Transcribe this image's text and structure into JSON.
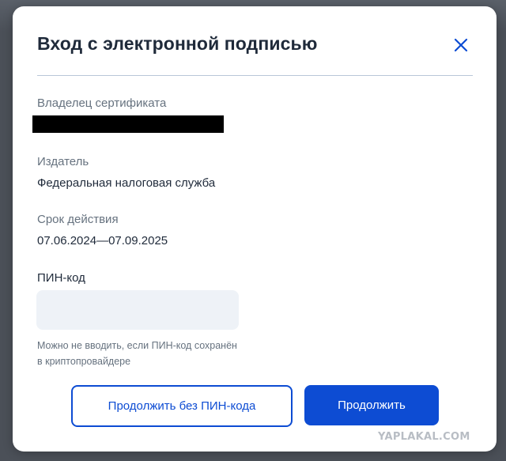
{
  "dialog": {
    "title": "Вход с электронной подписью",
    "close_icon": "close-icon"
  },
  "certificate": {
    "owner_label": "Владелец сертификата",
    "issuer_label": "Издатель",
    "issuer_value": "Федеральная налоговая служба",
    "validity_label": "Срок действия",
    "validity_value": "07.06.2024—07.09.2025"
  },
  "pin": {
    "label": "ПИН-код",
    "value": "",
    "placeholder": "",
    "hint": "Можно не вводить, если ПИН-код сохранён в криптопровайдере"
  },
  "actions": {
    "continue_without_pin_label": "Продолжить без ПИН-кода",
    "continue_label": "Продолжить"
  },
  "watermark": "YAPLAKAL.COM",
  "colors": {
    "accent": "#0d4cd3",
    "text_primary": "#1f2a3a",
    "text_secondary": "#66727f",
    "input_bg": "#eef2f7",
    "divider": "#b9c6d8"
  }
}
